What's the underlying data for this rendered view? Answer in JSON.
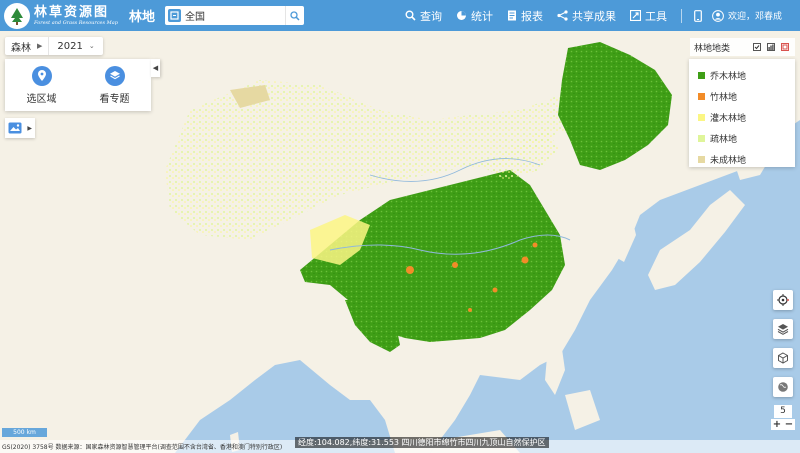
{
  "header": {
    "logo_cn": "林草资源图",
    "logo_en": "Forest and Grass Resources Map",
    "page_title": "林地",
    "search_value": "全国",
    "nav": [
      {
        "label": "查询",
        "icon": "search-icon"
      },
      {
        "label": "统计",
        "icon": "pie-chart-icon"
      },
      {
        "label": "报表",
        "icon": "report-icon"
      },
      {
        "label": "共享成果",
        "icon": "share-icon"
      },
      {
        "label": "工具",
        "icon": "tools-icon"
      }
    ],
    "user_greeting": "欢迎，邓春成"
  },
  "selectors": {
    "category": "森林",
    "year": "2021"
  },
  "tools": [
    {
      "label": "选区域",
      "icon": "location-pin-icon"
    },
    {
      "label": "看专题",
      "icon": "layers-icon"
    }
  ],
  "legend": {
    "title": "林地地类",
    "items": [
      {
        "label": "乔木林地",
        "color": "#3f9e16"
      },
      {
        "label": "竹林地",
        "color": "#f28c28"
      },
      {
        "label": "灌木林地",
        "color": "#fbf684"
      },
      {
        "label": "疏林地",
        "color": "#dff59a"
      },
      {
        "label": "未成林地",
        "color": "#e6d9a2"
      }
    ]
  },
  "map": {
    "zoom_level": "5",
    "zoom_in": "+",
    "zoom_out": "−",
    "scale": "500 km",
    "source": "GS(2020) 3758号  数据来源：国家森林资源智慧管理平台(调查范围不含台湾省、香港和澳门特别行政区)",
    "coordinates": "经度:104.082,纬度:31.553 四川德阳市绵竹市四川九顶山自然保护区",
    "colors": {
      "sea": "#a9cbe8",
      "land": "#f5f1e6",
      "topbar": "#4d9ad8"
    }
  }
}
